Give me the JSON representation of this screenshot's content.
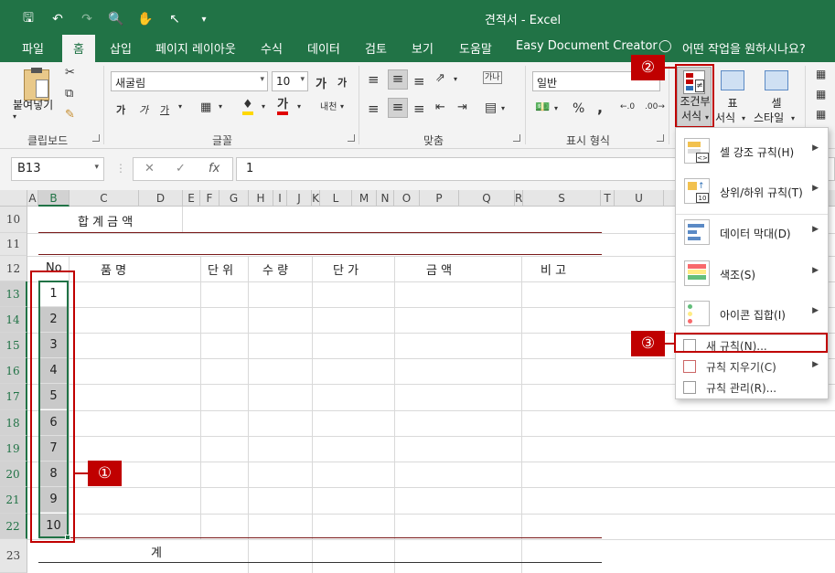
{
  "window": {
    "title": "견적서 - Excel",
    "accent": "#217346",
    "callout_color": "#c00000"
  },
  "qat": {
    "save_icon": "save-icon",
    "undo_icon": "undo-icon",
    "redo_icon": "redo-icon",
    "preview_icon": "print-preview-icon",
    "touch_icon": "touch-mode-icon",
    "pointer_icon": "pointer-icon",
    "more_icon": "customize-qat-icon"
  },
  "tabs": [
    "파일",
    "홈",
    "삽입",
    "페이지 레이아웃",
    "수식",
    "데이터",
    "검토",
    "보기",
    "도움말",
    "Easy Document Creator"
  ],
  "active_tab": "홈",
  "tell_me": "어떤 작업을 원하시나요?",
  "ribbon": {
    "clipboard": {
      "paste_label": "붙여넣기",
      "group": "클립보드"
    },
    "font": {
      "font_name": "새굴림",
      "font_size": "10",
      "grow": "가",
      "shrink": "가",
      "bold": "가",
      "italic": "가",
      "underline": "가",
      "font_color_glyph": "가",
      "phonetic": "내천",
      "group": "글꼴"
    },
    "alignment": {
      "wrap": "가나",
      "group": "맞춤"
    },
    "number": {
      "format": "일반",
      "percent": "%",
      "comma": ",",
      "group": "표시 형식"
    },
    "styles": {
      "conditional_line1": "조건부",
      "conditional_line2": "서식",
      "table_line1": "표",
      "table_line2": "서식",
      "cell_line1": "셀",
      "cell_line2": "스타일"
    }
  },
  "formula_bar": {
    "name_box": "B13",
    "cancel": "✕",
    "enter": "✓",
    "fx": "fx",
    "value": "1"
  },
  "columns": [
    "A",
    "B",
    "C",
    "D",
    "E",
    "F",
    "G",
    "H",
    "I",
    "J",
    "K",
    "L",
    "M",
    "N",
    "O",
    "P",
    "Q",
    "R",
    "S",
    "T",
    "U"
  ],
  "rows": [
    "10",
    "11",
    "12",
    "13",
    "14",
    "15",
    "16",
    "17",
    "18",
    "19",
    "20",
    "21",
    "22",
    "23"
  ],
  "sheet": {
    "total_title": "합 계 금 액",
    "headers": {
      "no": "No",
      "item": "품           명",
      "unit": "단  위",
      "qty": "수  량",
      "price": "단     가",
      "amount": "금             액",
      "note": "비     고"
    },
    "numbers": [
      "1",
      "2",
      "3",
      "4",
      "5",
      "6",
      "7",
      "8",
      "9",
      "10"
    ],
    "sum_label": "계"
  },
  "cf_menu": {
    "items": [
      {
        "label": "셀 강조 규칙(H)",
        "icon": "highlight-cells-rules-icon"
      },
      {
        "label": "상위/하위 규칙(T)",
        "icon": "top-bottom-rules-icon"
      },
      {
        "label": "데이터 막대(D)",
        "icon": "data-bars-icon"
      },
      {
        "label": "색조(S)",
        "icon": "color-scales-icon"
      },
      {
        "label": "아이콘 집합(I)",
        "icon": "icon-sets-icon"
      }
    ],
    "new_rule": "새 규칙(N)...",
    "clear_rules": "규칙 지우기(C)",
    "manage_rules": "규칙 관리(R)..."
  },
  "callouts": [
    "①",
    "②",
    "③"
  ]
}
